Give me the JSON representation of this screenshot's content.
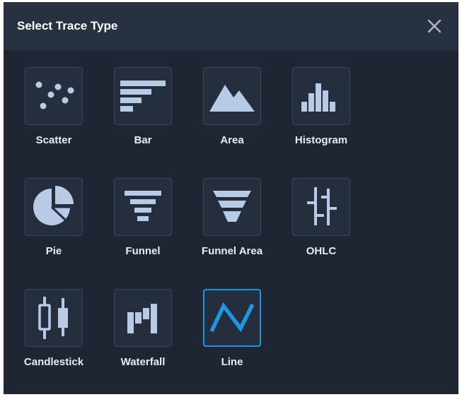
{
  "dialog": {
    "title": "Select Trace Type",
    "close_icon": "close-icon",
    "accent_color": "#1e96e6",
    "icon_color": "#b8cbe6"
  },
  "traces": [
    {
      "label": "Scatter",
      "icon": "scatter-icon",
      "selected": false
    },
    {
      "label": "Bar",
      "icon": "bar-icon",
      "selected": false
    },
    {
      "label": "Area",
      "icon": "area-icon",
      "selected": false
    },
    {
      "label": "Histogram",
      "icon": "histogram-icon",
      "selected": false
    },
    {
      "label": "Pie",
      "icon": "pie-icon",
      "selected": false
    },
    {
      "label": "Funnel",
      "icon": "funnel-icon",
      "selected": false
    },
    {
      "label": "Funnel Area",
      "icon": "funnel-area-icon",
      "selected": false
    },
    {
      "label": "OHLC",
      "icon": "ohlc-icon",
      "selected": false
    },
    {
      "label": "Candlestick",
      "icon": "candlestick-icon",
      "selected": false
    },
    {
      "label": "Waterfall",
      "icon": "waterfall-icon",
      "selected": false
    },
    {
      "label": "Line",
      "icon": "line-icon",
      "selected": true
    }
  ]
}
